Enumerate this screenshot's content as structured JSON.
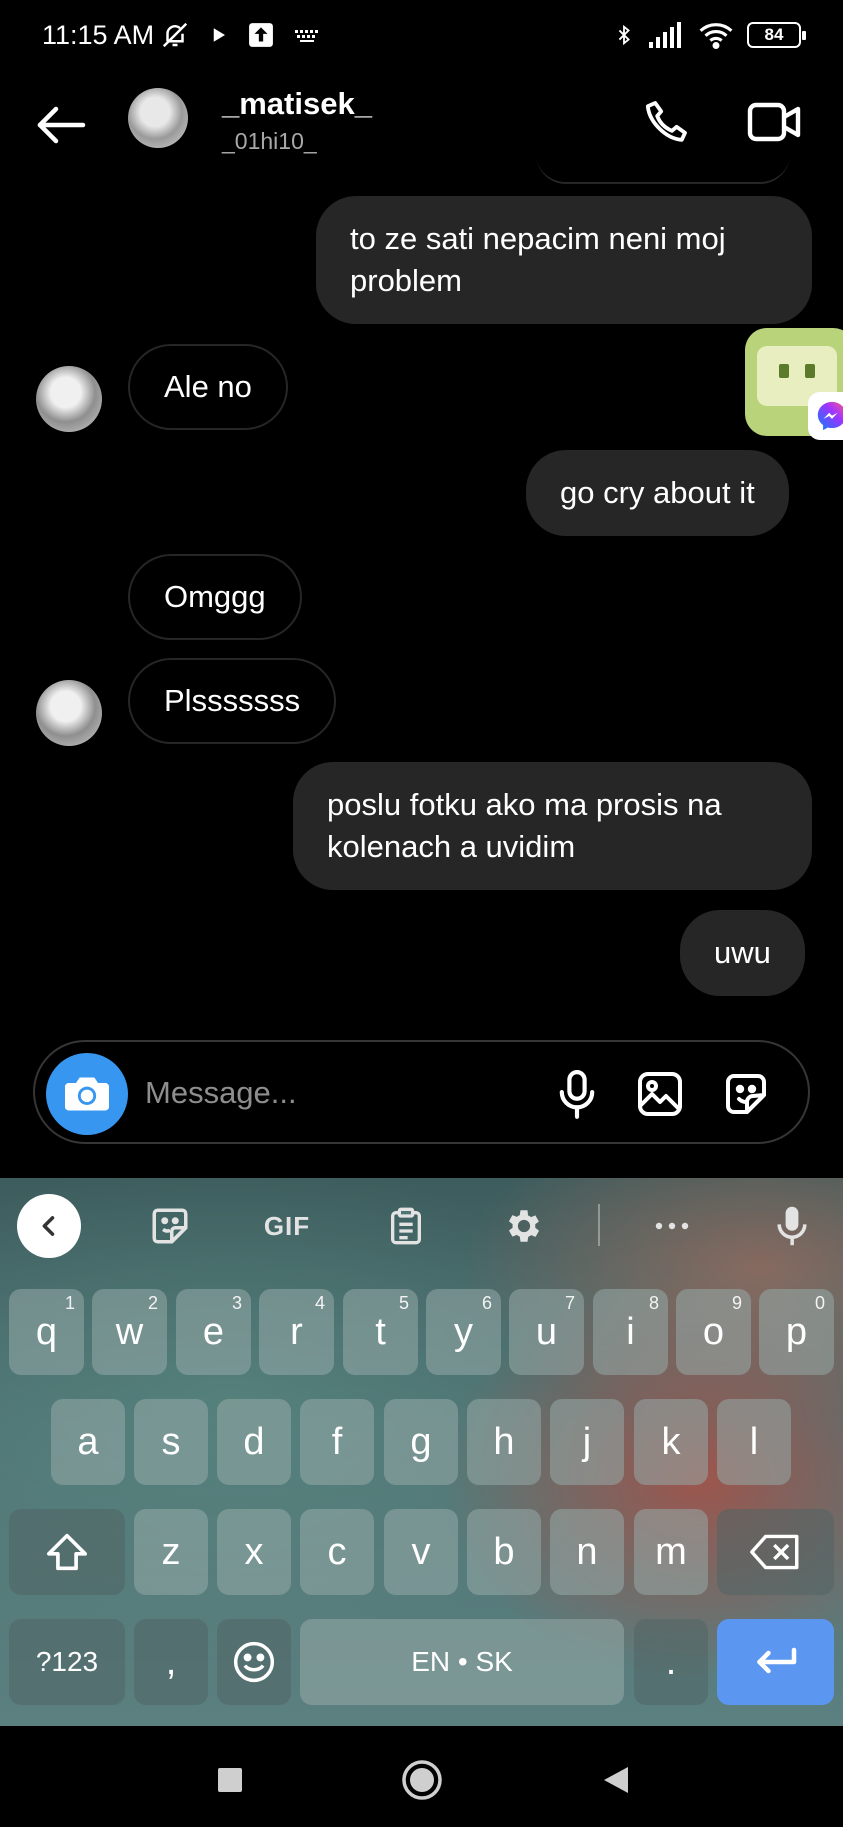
{
  "status_bar": {
    "time": "11:15 AM",
    "battery": "84",
    "left_icons": [
      "bell-off-icon",
      "play-icon",
      "upload-icon",
      "keyboard-icon"
    ],
    "right_icons": [
      "bluetooth-icon",
      "signal-icon",
      "wifi-icon",
      "battery-icon"
    ]
  },
  "header": {
    "name": "_matisek_",
    "username": "_01hi10_"
  },
  "messages": [
    {
      "side": "out",
      "text": "to ze sati nepacim neni moj problem"
    },
    {
      "side": "in",
      "text": "Ale no"
    },
    {
      "side": "out",
      "text": "go cry about it"
    },
    {
      "side": "in",
      "text": "Omggg"
    },
    {
      "side": "in",
      "text": "Plsssssss"
    },
    {
      "side": "out",
      "text": "poslu fotku ako ma prosis na kolenach a uvidim"
    },
    {
      "side": "out",
      "text": "uwu"
    }
  ],
  "composer": {
    "placeholder": "Message..."
  },
  "keyboard": {
    "toolbar": {
      "gif_label": "GIF"
    },
    "row1": [
      {
        "key": "q",
        "hint": "1"
      },
      {
        "key": "w",
        "hint": "2"
      },
      {
        "key": "e",
        "hint": "3"
      },
      {
        "key": "r",
        "hint": "4"
      },
      {
        "key": "t",
        "hint": "5"
      },
      {
        "key": "y",
        "hint": "6"
      },
      {
        "key": "u",
        "hint": "7"
      },
      {
        "key": "i",
        "hint": "8"
      },
      {
        "key": "o",
        "hint": "9"
      },
      {
        "key": "p",
        "hint": "0"
      }
    ],
    "row2": [
      "a",
      "s",
      "d",
      "f",
      "g",
      "h",
      "j",
      "k",
      "l"
    ],
    "row3": [
      "z",
      "x",
      "c",
      "v",
      "b",
      "n",
      "m"
    ],
    "row4": {
      "symbols": "?123",
      "comma": ",",
      "space": "EN • SK",
      "period": "."
    }
  },
  "colors": {
    "accent_blue": "#3797f0",
    "bubble_out": "#262626",
    "enter_key": "#5b96f1"
  }
}
